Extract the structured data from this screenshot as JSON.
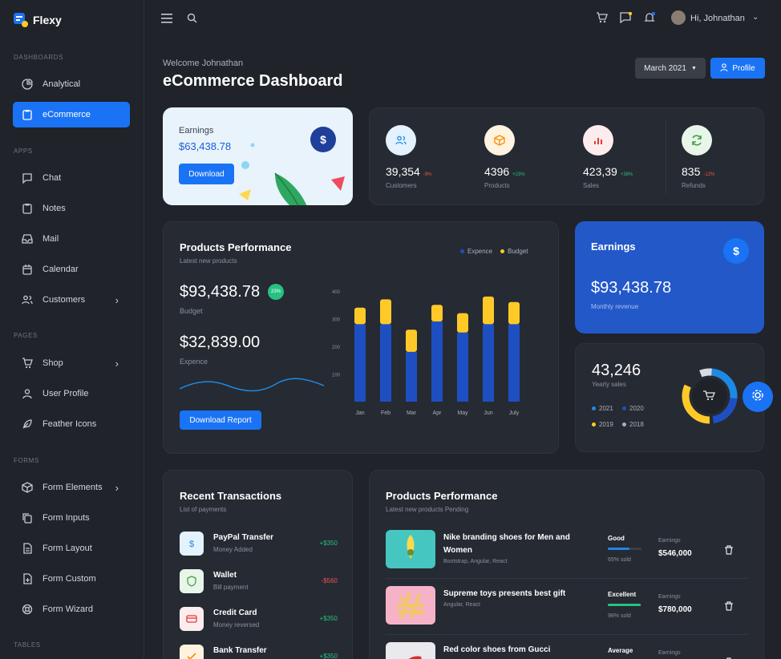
{
  "brand": {
    "name": "Flexy"
  },
  "sidebar": {
    "sections": [
      {
        "label": "DASHBOARDS",
        "items": [
          {
            "label": "Analytical",
            "icon": "pie-chart-icon",
            "active": false,
            "chevron": false
          },
          {
            "label": "eCommerce",
            "icon": "clipboard-icon",
            "active": true,
            "chevron": false
          }
        ]
      },
      {
        "label": "APPS",
        "items": [
          {
            "label": "Chat",
            "icon": "message-square-icon",
            "active": false,
            "chevron": false
          },
          {
            "label": "Notes",
            "icon": "clipboard-icon",
            "active": false,
            "chevron": false
          },
          {
            "label": "Mail",
            "icon": "inbox-icon",
            "active": false,
            "chevron": false
          },
          {
            "label": "Calendar",
            "icon": "calendar-icon",
            "active": false,
            "chevron": false
          },
          {
            "label": "Customers",
            "icon": "users-icon",
            "active": false,
            "chevron": true
          }
        ]
      },
      {
        "label": "PAGES",
        "items": [
          {
            "label": "Shop",
            "icon": "cart-icon",
            "active": false,
            "chevron": true
          },
          {
            "label": "User Profile",
            "icon": "user-icon",
            "active": false,
            "chevron": false
          },
          {
            "label": "Feather Icons",
            "icon": "feather-icon",
            "active": false,
            "chevron": false
          }
        ]
      },
      {
        "label": "FORMS",
        "items": [
          {
            "label": "Form Elements",
            "icon": "box-icon",
            "active": false,
            "chevron": true
          },
          {
            "label": "Form Inputs",
            "icon": "copy-icon",
            "active": false,
            "chevron": false
          },
          {
            "label": "Form Layout",
            "icon": "file-text-icon",
            "active": false,
            "chevron": false
          },
          {
            "label": "Form Custom",
            "icon": "file-plus-icon",
            "active": false,
            "chevron": false
          },
          {
            "label": "Form Wizard",
            "icon": "life-buoy-icon",
            "active": false,
            "chevron": false
          }
        ]
      },
      {
        "label": "TABLES",
        "items": []
      }
    ]
  },
  "topbar": {
    "greeting": "Hi, Johnathan"
  },
  "header": {
    "welcome": "Welcome Johnathan",
    "title": "eCommerce Dashboard",
    "month": "March 2021",
    "profile_label": "Profile"
  },
  "earnings_card": {
    "title": "Earnings",
    "amount": "$63,438.78",
    "button": "Download"
  },
  "stats": [
    {
      "value": "39,354",
      "pct": "-9%",
      "label": "Customers",
      "icon": "users-icon",
      "bg": "#e3f2fd",
      "fg": "#1e88e5",
      "pct_color": "#ef5350"
    },
    {
      "value": "4396",
      "pct": "+23%",
      "label": "Products",
      "icon": "box-icon",
      "bg": "#fff3e0",
      "fg": "#fb8c00",
      "pct_color": "#26c281"
    },
    {
      "value": "423,39",
      "pct": "+38%",
      "label": "Sales",
      "icon": "bar-chart-icon",
      "bg": "#fdecee",
      "fg": "#e53935",
      "pct_color": "#26c281"
    },
    {
      "value": "835",
      "pct": "-12%",
      "label": "Refunds",
      "icon": "refresh-icon",
      "bg": "#e8f5e9",
      "fg": "#43a047",
      "pct_color": "#ef5350"
    }
  ],
  "performance": {
    "title": "Products Performance",
    "subtitle": "Latest new products",
    "budget_amount": "$93,438.78",
    "budget_badge": "23%",
    "budget_label": "Budget",
    "expense_amount": "$32,839.00",
    "expense_label": "Expence",
    "button": "Download Report",
    "legend": [
      "Expence",
      "Budget"
    ]
  },
  "chart_data": {
    "type": "bar",
    "stacked": true,
    "categories": [
      "Jan",
      "Feb",
      "Mar",
      "Apr",
      "May",
      "Jun",
      "July"
    ],
    "series": [
      {
        "name": "Expence",
        "values": [
          280,
          280,
          180,
          290,
          250,
          280,
          280
        ],
        "color": "#1e4fc2"
      },
      {
        "name": "Budget",
        "values": [
          60,
          90,
          80,
          60,
          70,
          100,
          80
        ],
        "color": "#ffca28"
      }
    ],
    "yticks": [
      "100",
      "200",
      "300",
      "400"
    ],
    "ylim": [
      100,
      400
    ],
    "legend_position": "top-right",
    "grid": false
  },
  "earnings_blue": {
    "title": "Earnings",
    "amount": "$93,438.78",
    "sub": "Monthly revenue"
  },
  "yearly": {
    "value": "43,246",
    "label": "Yearly sales",
    "legend": [
      {
        "label": "2021",
        "color": "#1e88e5"
      },
      {
        "label": "2020",
        "color": "#1e4fc2"
      },
      {
        "label": "2019",
        "color": "#ffca28"
      },
      {
        "label": "2018",
        "color": "#aab0bb"
      }
    ]
  },
  "transactions": {
    "title": "Recent Transactions",
    "subtitle": "List of payments",
    "items": [
      {
        "title": "PayPal Transfer",
        "sub": "Money Added",
        "amount": "+$350",
        "amount_color": "#26c281",
        "icon": "dollar-icon",
        "bg": "#e3f2fd",
        "fg": "#1e88e5"
      },
      {
        "title": "Wallet",
        "sub": "Bill payment",
        "amount": "-$560",
        "amount_color": "#ef5350",
        "icon": "shield-icon",
        "bg": "#e8f5e9",
        "fg": "#43a047"
      },
      {
        "title": "Credit Card",
        "sub": "Money reversed",
        "amount": "+$350",
        "amount_color": "#26c281",
        "icon": "credit-card-icon",
        "bg": "#fdecee",
        "fg": "#e53935"
      },
      {
        "title": "Bank Transfer",
        "sub": "",
        "amount": "+$350",
        "amount_color": "#26c281",
        "icon": "check-icon",
        "bg": "#fff3e0",
        "fg": "#fb8c00"
      }
    ]
  },
  "products": {
    "title": "Products Performance",
    "subtitle": "Latest new products Pending",
    "rows": [
      {
        "title": "Nike branding shoes for Men and Women",
        "tags": "Bootstrap, Angular, React",
        "status": "Good",
        "sold": "65% sold",
        "progress": 0.65,
        "bar": "#1e88e5",
        "earn_label": "Earnings",
        "earn": "$546,000",
        "thumb": "#45c6c0"
      },
      {
        "title": "Supreme toys presents best gift",
        "tags": "Angular, React",
        "status": "Excellent",
        "sold": "98% sold",
        "progress": 0.98,
        "bar": "#26c281",
        "earn_label": "Earnings",
        "earn": "$780,000",
        "thumb": "#f6b3c8"
      },
      {
        "title": "Red color shoes from Gucci",
        "tags": "",
        "status": "Average",
        "sold": "",
        "progress": 0.5,
        "bar": "#ffca28",
        "earn_label": "Earnings",
        "earn": "",
        "thumb": "#e9e9ee"
      }
    ]
  }
}
